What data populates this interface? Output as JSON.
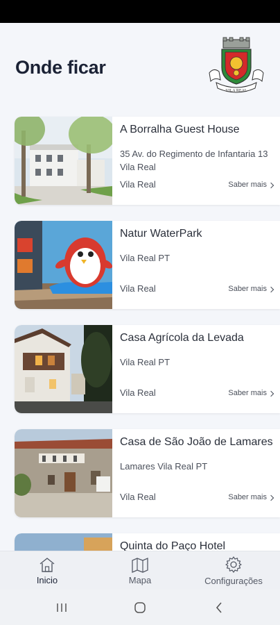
{
  "header": {
    "title": "Onde ficar",
    "crest_label": "VILA REAL"
  },
  "places": [
    {
      "name": "A Borralha Guest House",
      "address": "35 Av. do Regimento de Infantaria 13 Vila Real",
      "city": "Vila Real",
      "more_label": "Saber mais"
    },
    {
      "name": "Natur WaterPark",
      "address": "Vila Real PT",
      "city": "Vila Real",
      "more_label": "Saber mais"
    },
    {
      "name": "Casa Agrícola da Levada",
      "address": "Vila Real PT",
      "city": "Vila Real",
      "more_label": "Saber mais"
    },
    {
      "name": "Casa de São João de Lamares",
      "address": "Lamares Vila Real PT",
      "city": "Vila Real",
      "more_label": "Saber mais"
    },
    {
      "name": "Quinta do Paço Hotel",
      "address": "",
      "city": "",
      "more_label": ""
    }
  ],
  "tabs": [
    {
      "label": "Inicio",
      "icon": "home-icon",
      "active": true
    },
    {
      "label": "Mapa",
      "icon": "map-icon",
      "active": false
    },
    {
      "label": "Configurações",
      "icon": "gear-icon",
      "active": false
    }
  ],
  "system_nav": {
    "recents_icon": "recents-icon",
    "home_icon": "system-home-icon",
    "back_icon": "back-icon"
  },
  "colors": {
    "background": "#f4f6fa",
    "title": "#1b2235",
    "card": "#ffffff",
    "status_bar": "#000000"
  }
}
